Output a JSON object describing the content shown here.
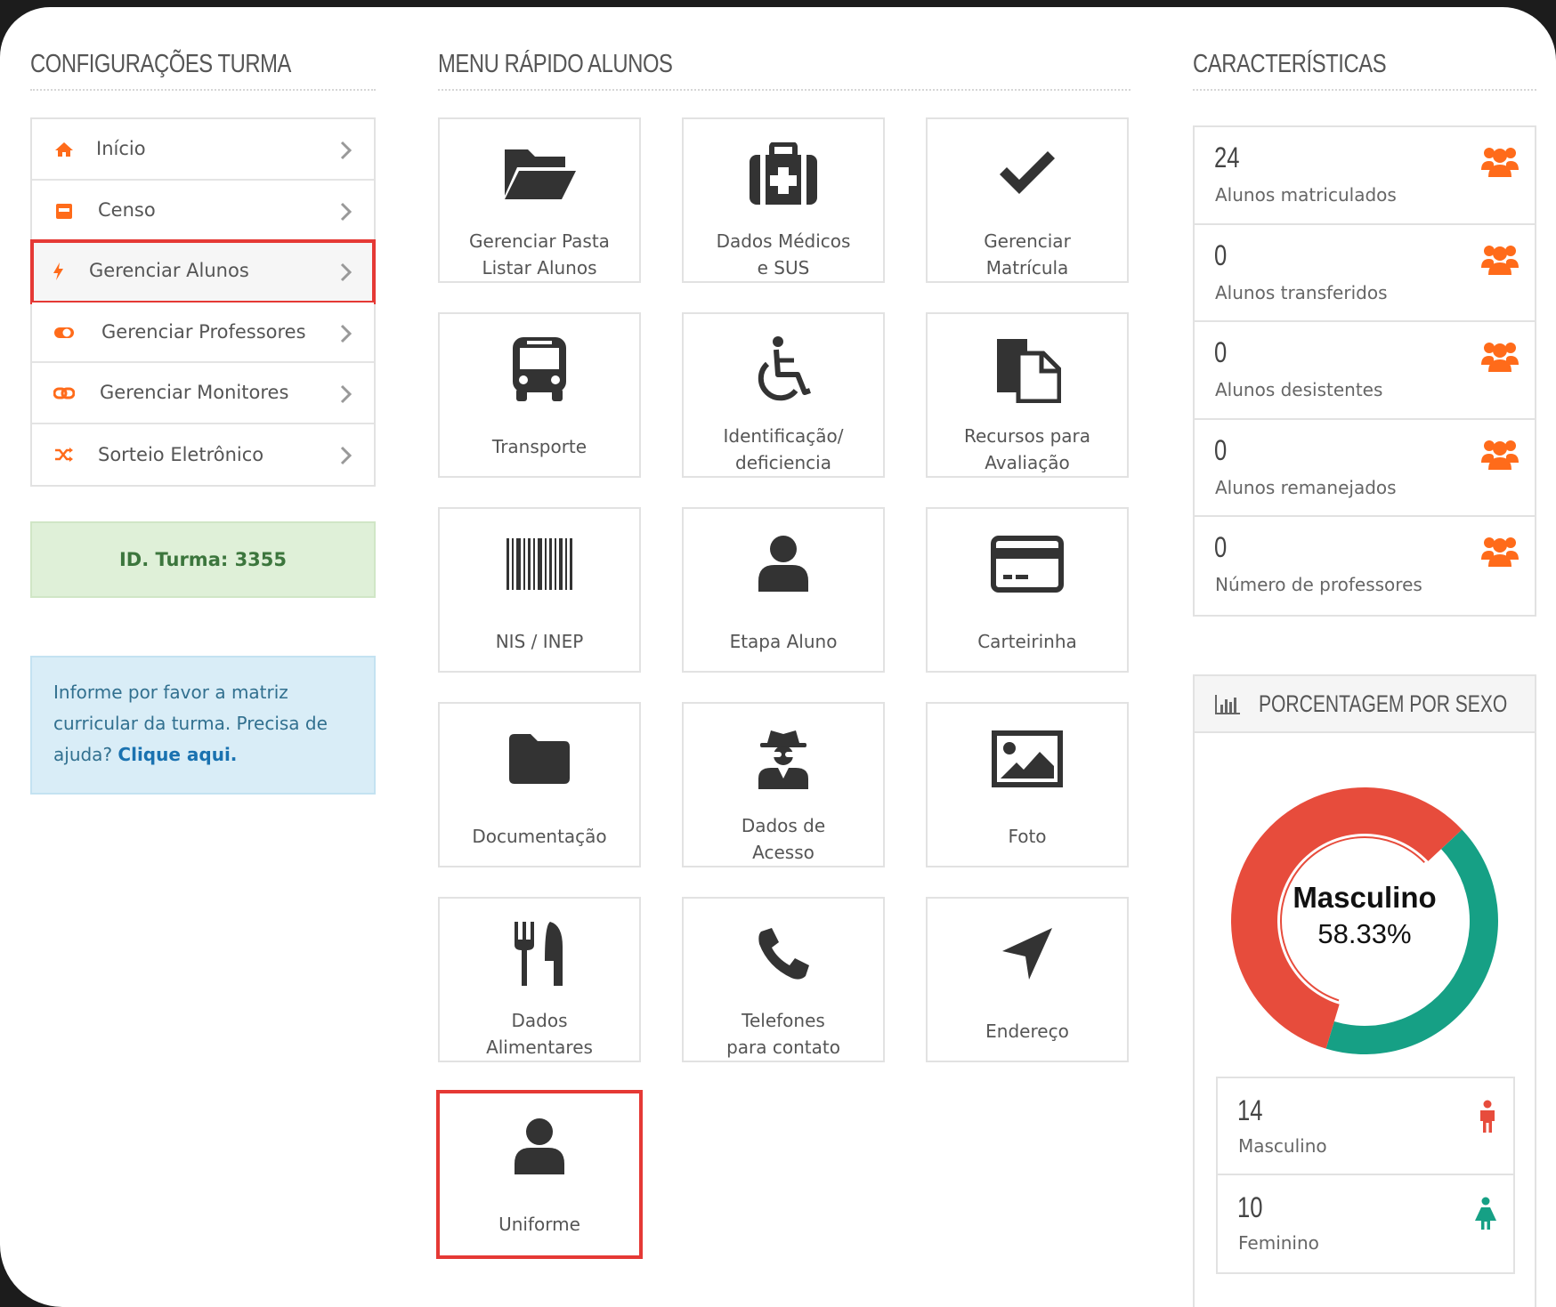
{
  "sections": {
    "config_title": "CONFIGURAÇÕES TURMA",
    "menu_title": "MENU RÁPIDO ALUNOS",
    "char_title": "CARACTERÍSTICAS"
  },
  "left_menu": [
    {
      "label": "Início",
      "icon": "home-icon"
    },
    {
      "label": "Censo",
      "icon": "calendar-icon"
    },
    {
      "label": "Gerenciar Alunos",
      "icon": "bolt-icon",
      "active": true
    },
    {
      "label": "Gerenciar Professores",
      "icon": "toggle-icon"
    },
    {
      "label": "Gerenciar Monitores",
      "icon": "link-icon"
    },
    {
      "label": "Sorteio Eletrônico",
      "icon": "shuffle-icon"
    }
  ],
  "id_box": "ID. Turma: 3355",
  "info_box": {
    "text": "Informe por favor a matriz curricular da turma. Precisa de ajuda?",
    "link": "Clique aqui."
  },
  "tiles": {
    "pasta": {
      "line1": "Gerenciar Pasta",
      "line2": "Listar Alunos"
    },
    "medicos": {
      "line1": "Dados Médicos",
      "line2": "e SUS"
    },
    "matricula": {
      "line1": "Gerenciar",
      "line2": "Matrícula"
    },
    "transporte": {
      "line1": "Transporte"
    },
    "identificacao": {
      "line1": "Identificação/",
      "line2": "deficiencia"
    },
    "recursos": {
      "line1": "Recursos para",
      "line2": "Avaliação"
    },
    "nis": {
      "line1": "NIS / INEP"
    },
    "etapa": {
      "line1": "Etapa Aluno"
    },
    "carteirinha": {
      "line1": "Carteirinha"
    },
    "documentacao": {
      "line1": "Documentação"
    },
    "acesso": {
      "line1": "Dados de",
      "line2": "Acesso"
    },
    "foto": {
      "line1": "Foto"
    },
    "alimentares": {
      "line1": "Dados",
      "line2": "Alimentares"
    },
    "telefones": {
      "line1": "Telefones",
      "line2": "para contato"
    },
    "endereco": {
      "line1": "Endereço"
    },
    "uniforme": {
      "line1": "Uniforme"
    }
  },
  "stats": [
    {
      "value": "24",
      "label": "Alunos matriculados"
    },
    {
      "value": "0",
      "label": "Alunos transferidos"
    },
    {
      "value": "0",
      "label": "Alunos desistentes"
    },
    {
      "value": "0",
      "label": "Alunos remanejados"
    },
    {
      "value": "0",
      "label": "Número de professores"
    }
  ],
  "pct_panel": {
    "title": "PORCENTAGEM POR SEXO",
    "donut_label": "Masculino",
    "donut_value": "58.33%",
    "male_fraction": 0.5833,
    "female_fraction": 0.4167
  },
  "sex_counts": [
    {
      "value": "14",
      "label": "Masculino",
      "icon": "male-icon"
    },
    {
      "value": "10",
      "label": "Feminino",
      "icon": "female-icon"
    }
  ],
  "colors": {
    "accent_orange": "#ff6b1a",
    "male_red": "#e74c3c",
    "female_teal": "#16a085",
    "highlight_red": "#e53935",
    "icon_dark": "#333333"
  }
}
